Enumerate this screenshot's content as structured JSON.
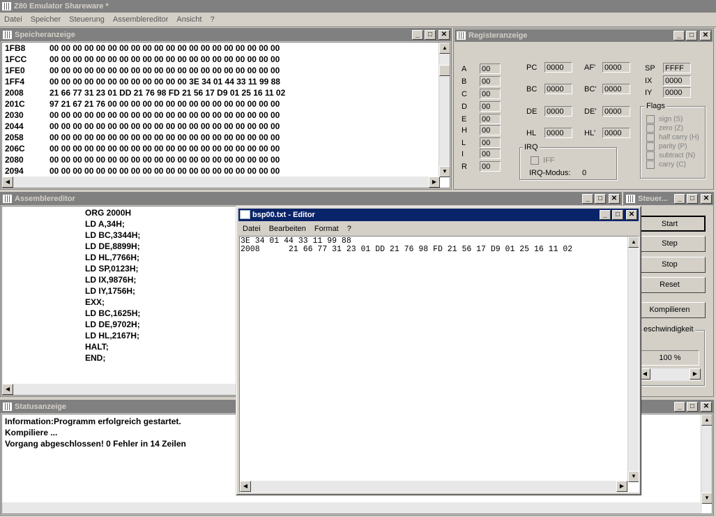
{
  "app": {
    "title": "Z80 Emulator Shareware *",
    "menu": [
      "Datei",
      "Speicher",
      "Steuerung",
      "Assemblereditor",
      "Ansicht",
      "?"
    ]
  },
  "memory": {
    "title": "Speicheranzeige",
    "rows": [
      {
        "addr": "1FB8",
        "bytes": "00 00 00 00 00 00 00 00 00 00 00 00 00 00 00 00 00 00 00 00"
      },
      {
        "addr": "1FCC",
        "bytes": "00 00 00 00 00 00 00 00 00 00 00 00 00 00 00 00 00 00 00 00"
      },
      {
        "addr": "1FE0",
        "bytes": "00 00 00 00 00 00 00 00 00 00 00 00 00 00 00 00 00 00 00 00"
      },
      {
        "addr": "1FF4",
        "bytes": "00 00 00 00 00 00 00 00 00 00 00 00 3E 34 01 44 33 11 99 88"
      },
      {
        "addr": "2008",
        "bytes": "21 66 77 31 23 01 DD 21 76 98 FD 21 56 17 D9 01 25 16 11 02"
      },
      {
        "addr": "201C",
        "bytes": "97 21 67 21 76 00 00 00 00 00 00 00 00 00 00 00 00 00 00 00"
      },
      {
        "addr": "2030",
        "bytes": "00 00 00 00 00 00 00 00 00 00 00 00 00 00 00 00 00 00 00 00"
      },
      {
        "addr": "2044",
        "bytes": "00 00 00 00 00 00 00 00 00 00 00 00 00 00 00 00 00 00 00 00"
      },
      {
        "addr": "2058",
        "bytes": "00 00 00 00 00 00 00 00 00 00 00 00 00 00 00 00 00 00 00 00"
      },
      {
        "addr": "206C",
        "bytes": "00 00 00 00 00 00 00 00 00 00 00 00 00 00 00 00 00 00 00 00"
      },
      {
        "addr": "2080",
        "bytes": "00 00 00 00 00 00 00 00 00 00 00 00 00 00 00 00 00 00 00 00"
      },
      {
        "addr": "2094",
        "bytes": "00 00 00 00 00 00 00 00 00 00 00 00 00 00 00 00 00 00 00 00"
      }
    ]
  },
  "registers": {
    "title": "Registeranzeige",
    "left": [
      {
        "n": "A",
        "v": "00"
      },
      {
        "n": "B",
        "v": "00"
      },
      {
        "n": "C",
        "v": "00"
      },
      {
        "n": "D",
        "v": "00"
      },
      {
        "n": "E",
        "v": "00"
      },
      {
        "n": "H",
        "v": "00"
      },
      {
        "n": "L",
        "v": "00"
      },
      {
        "n": "I",
        "v": "00"
      },
      {
        "n": "R",
        "v": "00"
      }
    ],
    "pc": {
      "n": "PC",
      "v": "0000"
    },
    "af2": {
      "n": "AF'",
      "v": "0000"
    },
    "bc": {
      "n": "BC",
      "v": "0000"
    },
    "bc2": {
      "n": "BC'",
      "v": "0000"
    },
    "de": {
      "n": "DE",
      "v": "0000"
    },
    "de2": {
      "n": "DE'",
      "v": "0000"
    },
    "hl": {
      "n": "HL",
      "v": "0000"
    },
    "hl2": {
      "n": "HL'",
      "v": "0000"
    },
    "sp": {
      "n": "SP",
      "v": "FFFF"
    },
    "ix": {
      "n": "IX",
      "v": "0000"
    },
    "iy": {
      "n": "IY",
      "v": "0000"
    },
    "irq": {
      "label": "IRQ",
      "iff": "IFF",
      "mode_label": "IRQ-Modus:",
      "mode": "0"
    },
    "flags": {
      "label": "Flags",
      "items": [
        "sign (S)",
        "zero (Z)",
        "half carry (H)",
        "parity (P)",
        "subtract (N)",
        "carry (C)"
      ]
    }
  },
  "asm": {
    "title": "Assemblereditor",
    "lines": [
      "ORG 2000H",
      "LD A,34H;",
      "LD BC,3344H;",
      "LD DE,8899H;",
      "LD HL,7766H;",
      "LD SP,0123H;",
      "LD IX,9876H;",
      "LD IY,1756H;",
      "EXX;",
      "LD BC,1625H;",
      "LD DE,9702H;",
      "LD HL,2167H;",
      "HALT;",
      "END;"
    ]
  },
  "control": {
    "title": "Steuer...",
    "buttons": {
      "start": "Start",
      "step": "Step",
      "stop": "Stop",
      "reset": "Reset",
      "compile": "Kompilieren"
    },
    "speed_label": "eschwindigkeit",
    "speed_value": "100 %"
  },
  "status": {
    "title": "Statusanzeige",
    "lines": [
      "Information:Programm erfolgreich gestartet.",
      "Kompiliere ...",
      "Vorgang abgeschlossen! 0 Fehler in 14 Zeilen"
    ]
  },
  "notepad": {
    "title": "bsp00.txt - Editor",
    "menu": [
      "Datei",
      "Bearbeiten",
      "Format",
      "?"
    ],
    "lines": [
      "3E 34 01 44 33 11 99 88",
      "2008      21 66 77 31 23 01 DD 21 76 98 FD 21 56 17 D9 01 25 16 11 02"
    ]
  }
}
